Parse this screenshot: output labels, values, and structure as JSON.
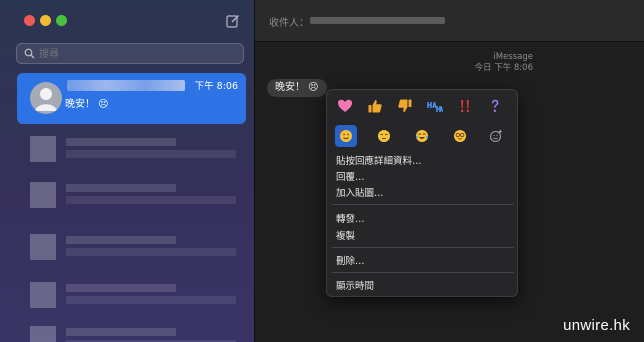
{
  "sidebar": {
    "search_placeholder": "搜尋",
    "conversation": {
      "time": "下午 8:06",
      "preview": "晚安！ 😣"
    }
  },
  "header": {
    "to_label": "收件人："
  },
  "thread": {
    "service": "iMessage",
    "timestamp": "今日 下午 8:06",
    "bubble_text": "晚安！ 😣"
  },
  "context_menu": {
    "tapbacks": [
      "heart",
      "thumbs-up",
      "thumbs-down",
      "haha",
      "exclamation",
      "question"
    ],
    "emoji_reactions": [
      "smiling-hearts",
      "unamused",
      "tears-of-joy",
      "nerd",
      "add-sticker"
    ],
    "items": {
      "sticker_details": "貼按回應詳細資料…",
      "reply": "回覆…",
      "add_sticker": "加入貼圖…",
      "forward": "轉發…",
      "copy": "複製",
      "delete": "刪除…",
      "show_times": "顯示時間"
    }
  },
  "watermark": "unwire.hk",
  "colors": {
    "accent": "#2d73e6",
    "selected_reaction": "#2864c8",
    "heart": "#f278b3",
    "thumb": "#f0a72c",
    "exclaim": "#e8353e",
    "question": "#a876ff"
  }
}
